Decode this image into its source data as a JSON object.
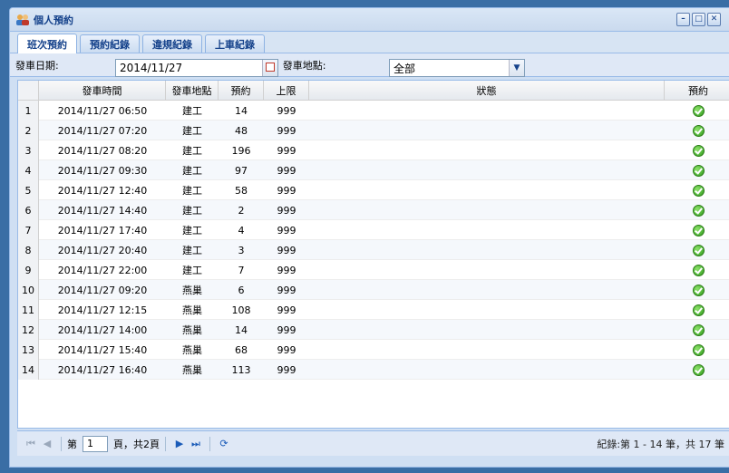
{
  "window": {
    "title": "個人預約",
    "icon": "users-icon"
  },
  "tabs": [
    "班次預約",
    "預約紀錄",
    "違規紀錄",
    "上車紀錄"
  ],
  "filters": {
    "date_label": "發車日期:",
    "date_value": "2014/11/27",
    "location_label": "發車地點:",
    "location_value": "全部"
  },
  "columns": [
    "發車時間",
    "發車地點",
    "預約",
    "上限",
    "狀態",
    "預約"
  ],
  "rows": [
    {
      "idx": "1",
      "time": "2014/11/27 06:50",
      "loc": "建工",
      "count": "14",
      "limit": "999"
    },
    {
      "idx": "2",
      "time": "2014/11/27 07:20",
      "loc": "建工",
      "count": "48",
      "limit": "999"
    },
    {
      "idx": "3",
      "time": "2014/11/27 08:20",
      "loc": "建工",
      "count": "196",
      "limit": "999"
    },
    {
      "idx": "4",
      "time": "2014/11/27 09:30",
      "loc": "建工",
      "count": "97",
      "limit": "999"
    },
    {
      "idx": "5",
      "time": "2014/11/27 12:40",
      "loc": "建工",
      "count": "58",
      "limit": "999"
    },
    {
      "idx": "6",
      "time": "2014/11/27 14:40",
      "loc": "建工",
      "count": "2",
      "limit": "999"
    },
    {
      "idx": "7",
      "time": "2014/11/27 17:40",
      "loc": "建工",
      "count": "4",
      "limit": "999"
    },
    {
      "idx": "8",
      "time": "2014/11/27 20:40",
      "loc": "建工",
      "count": "3",
      "limit": "999"
    },
    {
      "idx": "9",
      "time": "2014/11/27 22:00",
      "loc": "建工",
      "count": "7",
      "limit": "999"
    },
    {
      "idx": "10",
      "time": "2014/11/27 09:20",
      "loc": "燕巢",
      "count": "6",
      "limit": "999"
    },
    {
      "idx": "11",
      "time": "2014/11/27 12:15",
      "loc": "燕巢",
      "count": "108",
      "limit": "999"
    },
    {
      "idx": "12",
      "time": "2014/11/27 14:00",
      "loc": "燕巢",
      "count": "14",
      "limit": "999"
    },
    {
      "idx": "13",
      "time": "2014/11/27 15:40",
      "loc": "燕巢",
      "count": "68",
      "limit": "999"
    },
    {
      "idx": "14",
      "time": "2014/11/27 16:40",
      "loc": "燕巢",
      "count": "113",
      "limit": "999"
    }
  ],
  "pager": {
    "page_prefix": "第",
    "page_value": "1",
    "page_suffix": "頁，共2頁",
    "info": "紀錄:第 1 - 14 筆，共 17 筆"
  }
}
